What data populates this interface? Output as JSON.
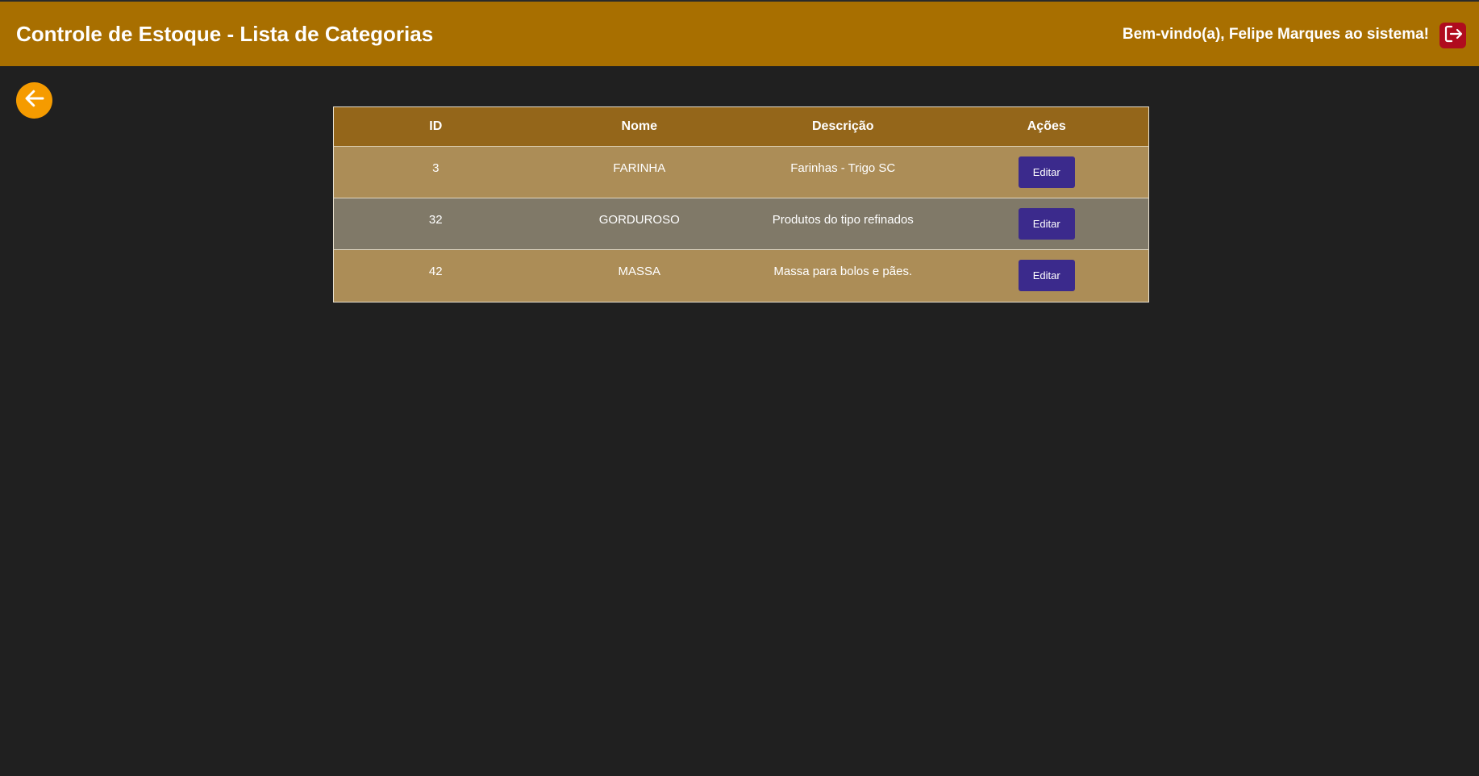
{
  "header": {
    "title": "Controle de Estoque - Lista de Categorias",
    "welcome": "Bem-vindo(a), Felipe Marques ao sistema!",
    "logout_icon": "logout-icon",
    "accent_color": "#a86f00",
    "logout_color": "#b00c1e"
  },
  "back": {
    "icon": "arrow-left-icon",
    "color": "#f59b00"
  },
  "table": {
    "columns": [
      "ID",
      "Nome",
      "Descrição",
      "Ações"
    ],
    "rows": [
      {
        "id": "3",
        "nome": "FARINHA",
        "descricao": "Farinhas - Trigo SC",
        "action": "Editar"
      },
      {
        "id": "32",
        "nome": "GORDUROSO",
        "descricao": "Produtos do tipo refinados",
        "action": "Editar"
      },
      {
        "id": "42",
        "nome": "MASSA",
        "descricao": "Massa para bolos e pães.",
        "action": "Editar"
      }
    ],
    "header_color": "#94661a",
    "row_colors": [
      "#ac8d57",
      "#807968"
    ],
    "button_color": "#3b2a8c"
  }
}
